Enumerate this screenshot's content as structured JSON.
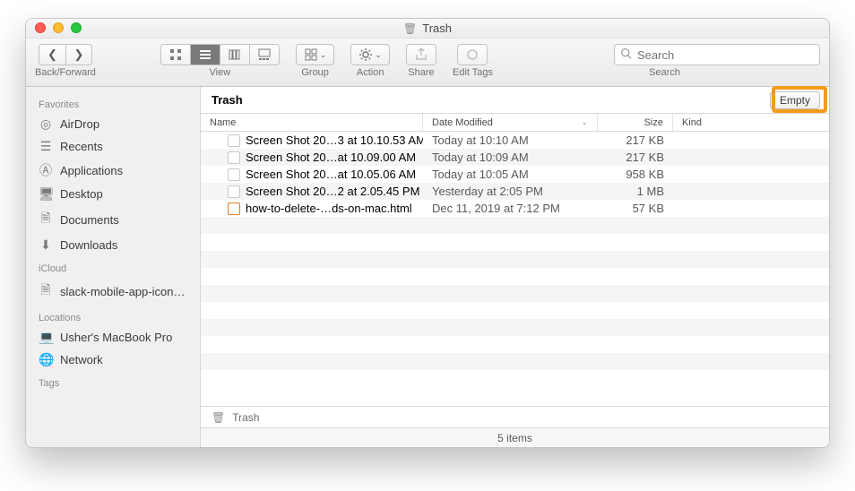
{
  "window": {
    "title": "Trash"
  },
  "toolbar": {
    "back_forward_label": "Back/Forward",
    "view_label": "View",
    "group_label": "Group",
    "action_label": "Action",
    "share_label": "Share",
    "edit_tags_label": "Edit Tags",
    "search_label": "Search",
    "search_placeholder": "Search"
  },
  "sidebar": {
    "sections": [
      {
        "title": "Favorites",
        "items": [
          {
            "label": "AirDrop",
            "icon": "airdrop-icon"
          },
          {
            "label": "Recents",
            "icon": "recents-icon"
          },
          {
            "label": "Applications",
            "icon": "applications-icon"
          },
          {
            "label": "Desktop",
            "icon": "desktop-icon"
          },
          {
            "label": "Documents",
            "icon": "documents-icon"
          },
          {
            "label": "Downloads",
            "icon": "downloads-icon"
          }
        ]
      },
      {
        "title": "iCloud",
        "items": [
          {
            "label": "slack-mobile-app-icon…",
            "icon": "document-icon"
          }
        ]
      },
      {
        "title": "Locations",
        "items": [
          {
            "label": "Usher's MacBook Pro",
            "icon": "computer-icon"
          },
          {
            "label": "Network",
            "icon": "network-icon"
          }
        ]
      },
      {
        "title": "Tags",
        "items": []
      }
    ]
  },
  "content": {
    "location_title": "Trash",
    "empty_label": "Empty",
    "columns": {
      "name": "Name",
      "date_modified": "Date Modified",
      "size": "Size",
      "kind": "Kind"
    },
    "rows": [
      {
        "name": "Screen Shot 20…3 at 10.10.53 AM",
        "date": "Today at 10:10 AM",
        "size": "217 KB",
        "icon": "png"
      },
      {
        "name": "Screen Shot 20…at 10.09.00 AM",
        "date": "Today at 10:09 AM",
        "size": "217 KB",
        "icon": "png"
      },
      {
        "name": "Screen Shot 20…at 10.05.06 AM",
        "date": "Today at 10:05 AM",
        "size": "958 KB",
        "icon": "png"
      },
      {
        "name": "Screen Shot 20…2 at 2.05.45 PM",
        "date": "Yesterday at 2:05 PM",
        "size": "1 MB",
        "icon": "png"
      },
      {
        "name": "how-to-delete-…ds-on-mac.html",
        "date": "Dec 11, 2019 at 7:12 PM",
        "size": "57 KB",
        "icon": "html"
      }
    ]
  },
  "pathbar": {
    "location": "Trash"
  },
  "status": {
    "text": "5 items"
  }
}
